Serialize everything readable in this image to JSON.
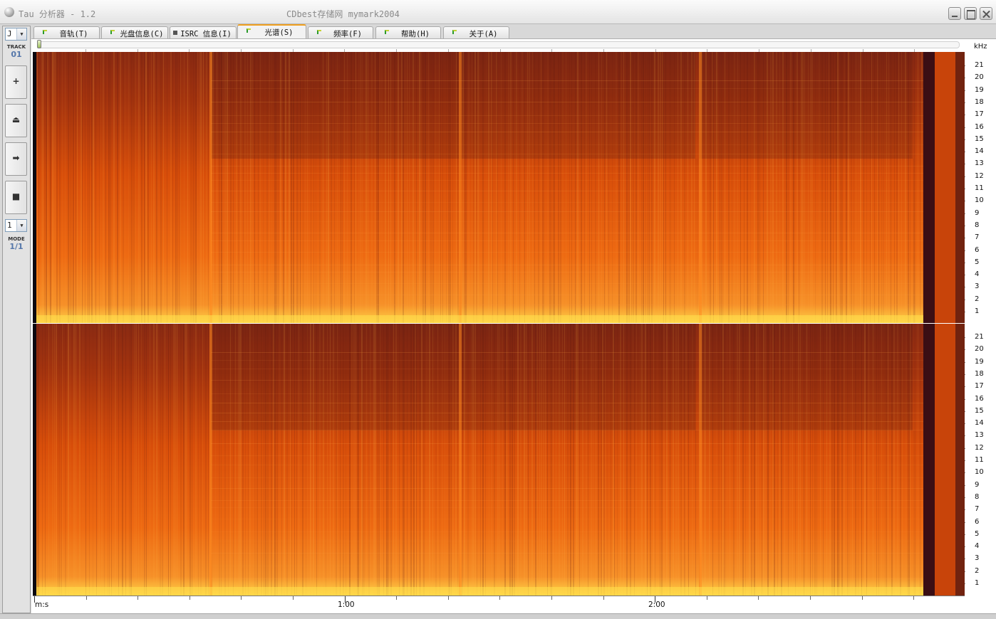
{
  "window": {
    "title": "Tau 分析器 - 1.2",
    "watermark": "CDbest存储网 mymark2004",
    "controls": [
      "minimize",
      "maximize",
      "close"
    ]
  },
  "tabs": [
    {
      "label": "音轨(T)",
      "icon": "green-flag-icon",
      "active": false
    },
    {
      "label": "光盘信息(C)",
      "icon": "green-flag-icon",
      "active": false
    },
    {
      "label": "ISRC 信息(I)",
      "icon": "grey-square-icon",
      "active": false
    },
    {
      "label": "光谱(S)",
      "icon": "green-flag-icon",
      "active": true
    },
    {
      "label": "频率(F)",
      "icon": "green-flag-icon",
      "active": false
    },
    {
      "label": "帮助(H)",
      "icon": "green-flag-icon",
      "active": false
    },
    {
      "label": "关于(A)",
      "icon": "green-flag-icon",
      "active": false
    }
  ],
  "left_panel": {
    "track_select": "J",
    "track_label": "TRACK",
    "track_number": "01",
    "buttons": [
      {
        "icon": "plus-icon",
        "glyph": "+"
      },
      {
        "icon": "eject-icon",
        "glyph": "⏏"
      },
      {
        "icon": "next-icon",
        "glyph": "➡"
      },
      {
        "icon": "stop-icon",
        "glyph": "■"
      }
    ],
    "mode_select": "1",
    "mode_label": "MODE",
    "mode_value": "1/1"
  },
  "spectrum": {
    "khz_unit": "kHz",
    "khz_labels": [
      "21",
      "20",
      "19",
      "18",
      "17",
      "16",
      "15",
      "14",
      "13",
      "12",
      "11",
      "10",
      "9",
      "8",
      "7",
      "6",
      "5",
      "4",
      "3",
      "2",
      "1"
    ],
    "channels": 2,
    "colors": {
      "low": "#3a0e14",
      "mid": "#e85a0a",
      "high": "#ffd84a"
    }
  },
  "time_axis": {
    "unit": "m:s",
    "labels": [
      "1:00",
      "2:00"
    ]
  }
}
